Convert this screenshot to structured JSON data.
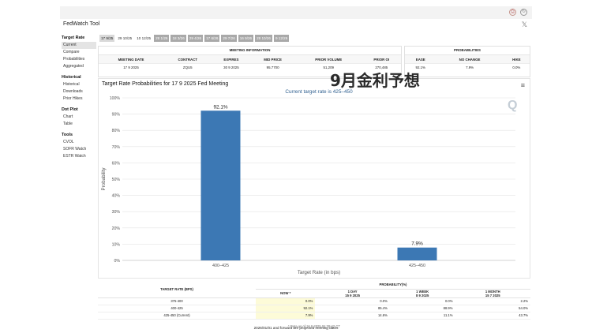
{
  "app": {
    "title": "FedWatch Tool"
  },
  "overlay": {
    "text": "9月金利予想"
  },
  "sidebar": {
    "sections": [
      {
        "heading": "Target Rate",
        "items": [
          "Current",
          "Compare",
          "Probabilities",
          "Aggregated"
        ]
      },
      {
        "heading": "Historical",
        "items": [
          "Historical",
          "Downloads",
          "Prior Hikes"
        ]
      },
      {
        "heading": "Dot Plot",
        "items": [
          "Chart",
          "Table"
        ]
      },
      {
        "heading": "Tools",
        "items": [
          "CVOL",
          "SOFR Watch",
          "ESTR Watch"
        ]
      }
    ],
    "active_item": "Current"
  },
  "tabs": [
    "17 9/25",
    "29 10/25",
    "10 12/25",
    "28 1/26",
    "18 3/26",
    "29 4/26",
    "17 6/26",
    "29 7/26",
    "16 9/26",
    "28 10/26",
    "9 12/26"
  ],
  "meeting_info": {
    "title": "MEETING INFORMATION",
    "headers": [
      "MEETING DATE",
      "CONTRACT",
      "EXPIRES",
      "MID PRICE",
      "PRIOR VOLUME",
      "PRIOR OI"
    ],
    "row": [
      "17 9 2025",
      "ZQU5",
      "30 9 2025",
      "95.7700",
      "51,209",
      "270,485"
    ]
  },
  "probabilities": {
    "title": "PROBABILITIES",
    "headers": [
      "EASE",
      "NO CHANGE",
      "HIKE"
    ],
    "row": [
      "92.1%",
      "7.9%",
      "0.0%"
    ]
  },
  "chart_title": "Target Rate Probabilities for 17 9 2025 Fed Meeting",
  "chart_data": {
    "type": "bar",
    "subtitle": "Current target rate is 425–450",
    "categories": [
      "400–425",
      "425–450"
    ],
    "values": [
      92.1,
      7.9
    ],
    "data_labels": [
      "92.1%",
      "7.9%"
    ],
    "xlabel": "Target Rate (in bps)",
    "ylabel": "Probability",
    "ylim": [
      0,
      100
    ],
    "yticks": [
      "0%",
      "10%",
      "20%",
      "30%",
      "40%",
      "50%",
      "60%",
      "70%",
      "80%",
      "90%",
      "100%"
    ],
    "bar_color": "#3c78b4",
    "grid": true
  },
  "bottom_table": {
    "headers": {
      "rate": "TARGET RATE (BPS)",
      "group": "PROBABILITY(%)",
      "now": "NOW *",
      "day": "1 DAY",
      "day_date": "15 9 2025",
      "week": "1 WEEK",
      "week_date": "8 9 2025",
      "month": "1 MONTH",
      "month_date": "15 7 2025"
    },
    "rows": [
      {
        "rate": "375-400",
        "now": "0.0%",
        "day": "0.0%",
        "week": "0.0%",
        "month": "2.2%"
      },
      {
        "rate": "400-425",
        "now": "92.1%",
        "day": "85.4%",
        "week": "88.9%",
        "month": "54.0%"
      },
      {
        "rate": "425-450 (Current)",
        "now": "7.9%",
        "day": "14.6%",
        "week": "11.1%",
        "month": "43.7%"
      }
    ],
    "footnote": "* Data as of 16 9 2025 01:39:42 CT"
  },
  "bottom_note": "2026/01/01 and forward are projected meeting dates",
  "icons": {
    "close": "close-icon",
    "menu": "hamburger-icon",
    "refresh": "refresh-icon",
    "print": "print-icon",
    "logo": "q-logo-icon"
  }
}
